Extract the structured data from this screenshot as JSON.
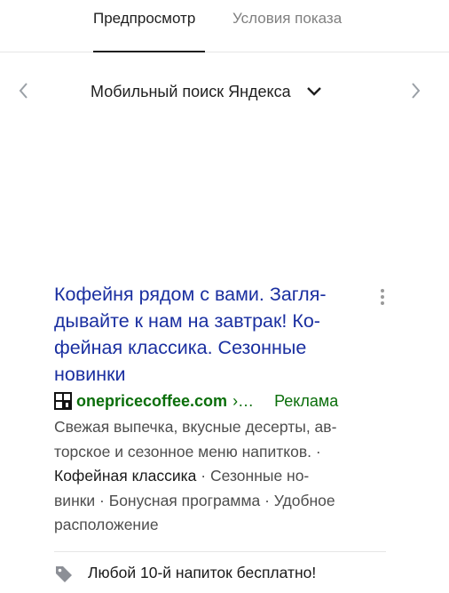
{
  "tabs": [
    {
      "label": "Предпросмотр",
      "active": true
    },
    {
      "label": "Условия показа",
      "active": false
    }
  ],
  "device_selector": {
    "label": "Мобильный поиск Яндекса",
    "prev_icon": "chevron-left-icon",
    "next_icon": "chevron-right-icon",
    "dropdown_icon": "chevron-down-icon"
  },
  "ad": {
    "title": "Кофейня рядом с вами. Загля-дывайте к нам на завтрак! Ко-фейная классика. Сезонные новинки",
    "title_lines": [
      "Кофейня рядом с вами. Загля-",
      "дывайте к нам на завтрак! Ко-",
      "фейная классика. Сезонные",
      "новинки"
    ],
    "domain": "onepricecoffee.com",
    "path": "›…",
    "ad_label": "Реклама",
    "description": "Свежая выпечка, вкусные десерты, авторское и сезонное меню напитков.",
    "description_lines": [
      "Свежая выпечка, вкусные десерты, ав-",
      "торское и сезонное меню напитков. ·"
    ],
    "sitelinks": [
      "Кофейная классика",
      "Сезонные новинки",
      "Бонусная программа",
      "Удобное расположение"
    ],
    "sitelink_parts": {
      "first": "Кофейная классика",
      "rest_line3": "· Сезонные но-",
      "rest_line4": "винки · Бонусная программа · Удобное",
      "rest_line5": "расположение"
    },
    "callout": "Любой 10-й напиток бесплатно!"
  },
  "colors": {
    "title": "#1a2fa0",
    "url": "#0a6e0a",
    "text": "#4d4d4d",
    "active_tab": "#1f1f1f",
    "inactive_tab": "#808080"
  }
}
